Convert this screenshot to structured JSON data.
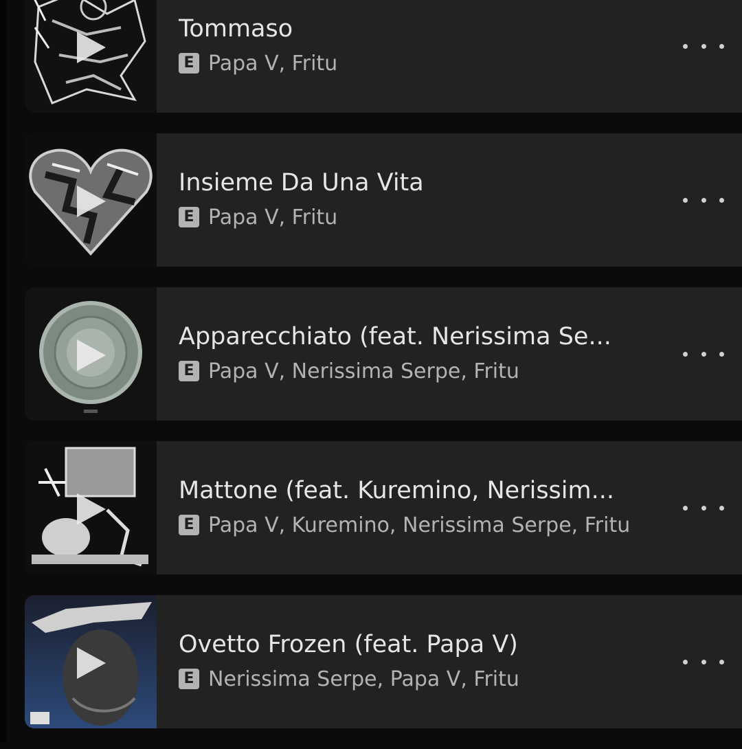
{
  "tracks": [
    {
      "title": "Tommaso",
      "explicit_badge": "E",
      "artists": "Papa V, Fritu",
      "artwork_icon": "album-art-sketch-icon",
      "more_icon": "more-options-icon"
    },
    {
      "title": "Insieme Da Una Vita",
      "explicit_badge": "E",
      "artists": "Papa V, Fritu",
      "artwork_icon": "album-art-chrome-heart-icon",
      "more_icon": "more-options-icon"
    },
    {
      "title": "Apparecchiato (feat. Nerissima Se...",
      "explicit_badge": "E",
      "artists": "Papa V, Nerissima Serpe, Fritu",
      "artwork_icon": "album-art-plate-icon",
      "more_icon": "more-options-icon"
    },
    {
      "title": "Mattone (feat. Kuremino, Nerissim...",
      "explicit_badge": "E",
      "artists": "Papa V, Kuremino, Nerissima Serpe, Fritu",
      "artwork_icon": "album-art-collage-icon",
      "more_icon": "more-options-icon"
    },
    {
      "title": "Ovetto Frozen (feat. Papa V)",
      "explicit_badge": "E",
      "artists": "Nerissima Serpe, Papa V, Fritu",
      "artwork_icon": "album-art-portrait-icon",
      "more_icon": "more-options-icon"
    }
  ],
  "colors": {
    "background": "#0b0b0b",
    "card": "#222222",
    "title_text": "#e6e6e6",
    "secondary_text": "#b3b3b3"
  }
}
